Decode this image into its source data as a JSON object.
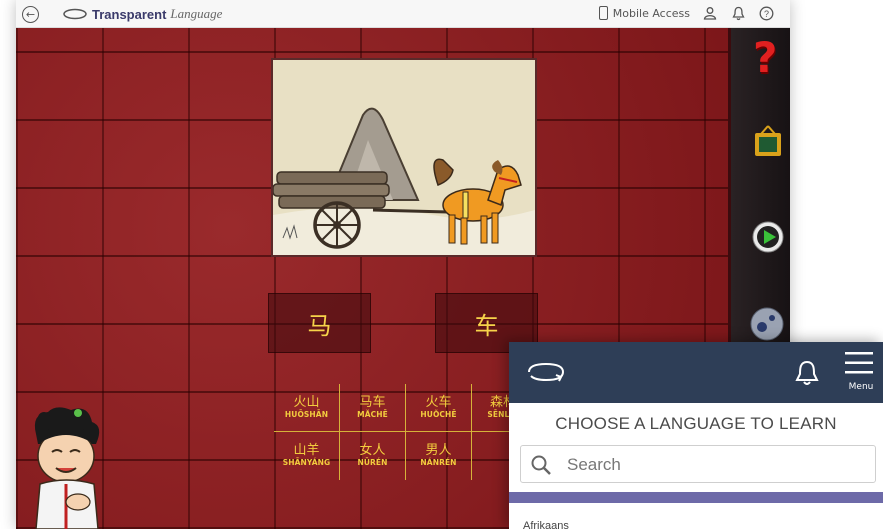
{
  "app": {
    "brand_name": "Transparent",
    "brand_language": "Language",
    "mobile_access_label": "Mobile Access"
  },
  "lesson": {
    "tiles": [
      {
        "hanzi": "马"
      },
      {
        "hanzi": "车"
      }
    ],
    "grid": [
      {
        "hanzi": "火山",
        "pinyin": "HUŌSHĀN"
      },
      {
        "hanzi": "马车",
        "pinyin": "MĂCHĒ"
      },
      {
        "hanzi": "火车",
        "pinyin": "HUŎCHĒ"
      },
      {
        "hanzi": "森林",
        "pinyin": "SĒNLÍN"
      },
      {
        "hanzi": "山羊",
        "pinyin": "SHĀNYÁNG"
      },
      {
        "hanzi": "女人",
        "pinyin": "NŪRÉN"
      },
      {
        "hanzi": "男人",
        "pinyin": "NÁNRÉN"
      },
      {
        "hanzi": "",
        "pinyin": ""
      }
    ]
  },
  "mobile": {
    "menu_label": "Menu",
    "title": "CHOOSE A LANGUAGE TO LEARN",
    "search_placeholder": "Search",
    "cutoff_text": "Afrikaans"
  },
  "colors": {
    "stage_red": "#8a1f22",
    "gold_text": "#f2cc3e",
    "mobile_header": "#2e3e57",
    "divider": "#6d6aa8",
    "help_red": "#e12020"
  }
}
